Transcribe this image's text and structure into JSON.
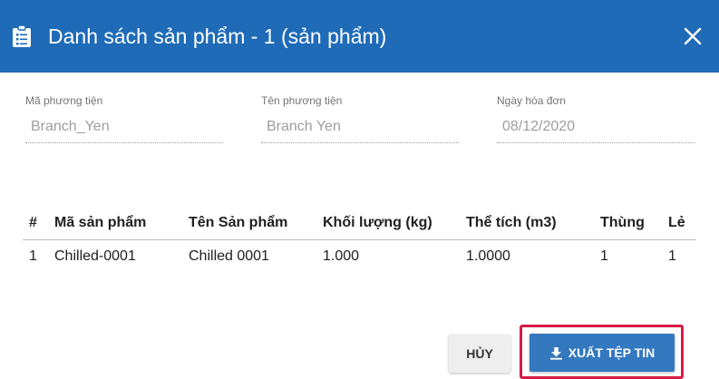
{
  "dialog": {
    "title": "Danh sách sản phẩm - 1 (sản phẩm)",
    "header_color": "#1f6bb8",
    "icons": {
      "title": "clipboard-icon",
      "close": "close-icon",
      "export": "download-icon"
    }
  },
  "fields": [
    {
      "label": "Mã phương tiện",
      "value": "Branch_Yen"
    },
    {
      "label": "Tên phương tiện",
      "value": "Branch Yen"
    },
    {
      "label": "Ngày hóa đơn",
      "value": "08/12/2020"
    }
  ],
  "table": {
    "headers": [
      "#",
      "Mã sản phẩm",
      "Tên Sản phẩm",
      "Khối lượng (kg)",
      "Thể tích (m3)",
      "Thùng",
      "Lẻ"
    ],
    "rows": [
      [
        "1",
        "Chilled-0001",
        "Chilled 0001",
        "1.000",
        "1.0000",
        "1",
        "1"
      ]
    ]
  },
  "buttons": {
    "cancel_label": "HỦY",
    "export_label": "XUẤT TỆP TIN",
    "export_color": "#3478c0",
    "highlight_color": "#d81b46"
  }
}
